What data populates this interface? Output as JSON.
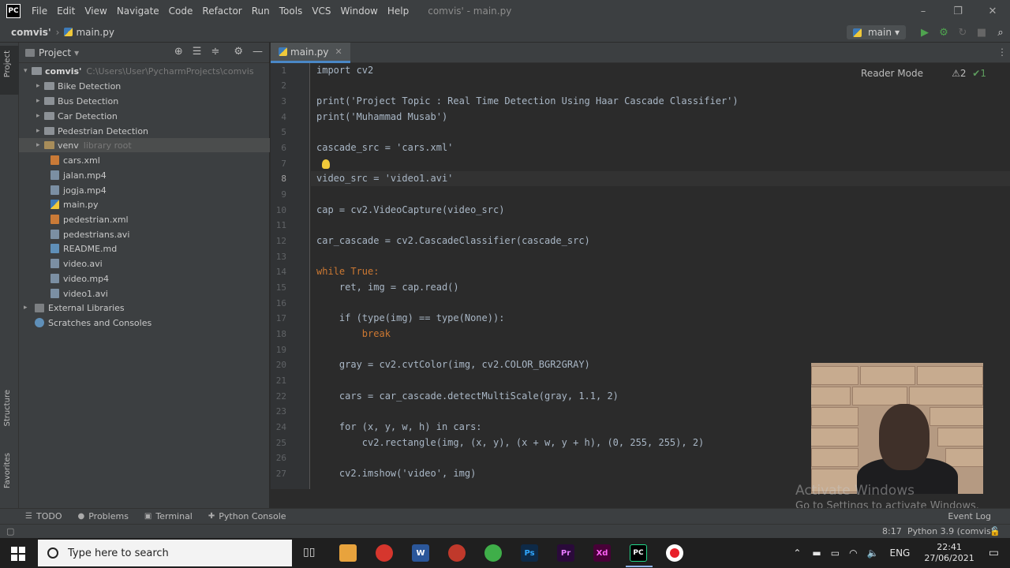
{
  "app": {
    "logo": "PC",
    "menu": [
      "File",
      "Edit",
      "View",
      "Navigate",
      "Code",
      "Refactor",
      "Run",
      "Tools",
      "VCS",
      "Window",
      "Help"
    ],
    "title": "comvis' - main.py",
    "window_buttons": [
      "–",
      "❐",
      "✕"
    ]
  },
  "navbar": {
    "project": "comvis'",
    "file": "main.py",
    "run_config": "main",
    "tool_icons": [
      "▶",
      "⚙",
      "↻",
      "■",
      "⌕"
    ]
  },
  "leftstrip": {
    "project_label": "Project",
    "structure_label": "Structure",
    "favorites_label": "Favorites"
  },
  "project_panel": {
    "header": "Project",
    "root": {
      "name": "comvis'",
      "path": "C:\\Users\\User\\PycharmProjects\\comvis"
    },
    "folders": [
      {
        "name": "Bike Detection"
      },
      {
        "name": "Bus Detection"
      },
      {
        "name": "Car Detection"
      },
      {
        "name": "Pedestrian Detection"
      },
      {
        "name": "venv",
        "hint": "library root"
      }
    ],
    "files": [
      {
        "name": "cars.xml",
        "type": "xml"
      },
      {
        "name": "jalan.mp4",
        "type": "vid"
      },
      {
        "name": "jogja.mp4",
        "type": "vid"
      },
      {
        "name": "main.py",
        "type": "py"
      },
      {
        "name": "pedestrian.xml",
        "type": "xml"
      },
      {
        "name": "pedestrians.avi",
        "type": "vid"
      },
      {
        "name": "README.md",
        "type": "md"
      },
      {
        "name": "video.avi",
        "type": "vid"
      },
      {
        "name": "video.mp4",
        "type": "vid"
      },
      {
        "name": "video1.avi",
        "type": "vid"
      }
    ],
    "external_libraries": "External Libraries",
    "scratches": "Scratches and Consoles"
  },
  "editor": {
    "tab": "main.py",
    "reader_mode": "Reader Mode",
    "warnings": "⚠2",
    "checks": "✔1",
    "line_numbers": [
      "1",
      "2",
      "3",
      "4",
      "5",
      "6",
      "7",
      "8",
      "9",
      "10",
      "11",
      "12",
      "13",
      "14",
      "15",
      "16",
      "17",
      "18",
      "19",
      "20",
      "21",
      "22",
      "23",
      "24",
      "25",
      "26",
      "27"
    ],
    "code": {
      "l1": "import cv2",
      "l3": "print('Project Topic : Real Time Detection Using Haar Cascade Classifier')",
      "l4": "print('Muhammad Musab')",
      "l6": "cascade_src = 'cars.xml'",
      "l8": "video_src = 'video1.avi'",
      "l10": "cap = cv2.VideoCapture(video_src)",
      "l12": "car_cascade = cv2.CascadeClassifier(cascade_src)",
      "l14": "while True:",
      "l15": "    ret, img = cap.read()",
      "l17": "    if (type(img) == type(None)):",
      "l18": "        break",
      "l20": "    gray = cv2.cvtColor(img, cv2.COLOR_BGR2GRAY)",
      "l22": "    cars = car_cascade.detectMultiScale(gray, 1.1, 2)",
      "l24": "    for (x, y, w, h) in cars:",
      "l25": "        cv2.rectangle(img, (x, y), (x + w, y + h), (0, 255, 255), 2)",
      "l27": "    cv2.imshow('video', img)"
    }
  },
  "watermark": {
    "line1": "Activate Windows",
    "line2": "Go to Settings to activate Windows."
  },
  "bottom_tools": {
    "todo": "TODO",
    "problems": "Problems",
    "terminal": "Terminal",
    "python_console": "Python Console",
    "event_log": "Event Log"
  },
  "status": {
    "position": "8:17",
    "interpreter": "Python 3.9 (comvis')"
  },
  "taskbar": {
    "search_placeholder": "Type here to search",
    "language": "ENG",
    "time": "22:41",
    "date": "27/06/2021",
    "apps": [
      {
        "label": "",
        "color": "#e8a33d"
      },
      {
        "label": "",
        "color": "#d6362d"
      },
      {
        "label": "W",
        "color": "#2b579a"
      },
      {
        "label": "",
        "color": "#c0392b"
      },
      {
        "label": "",
        "color": "#3fae49"
      },
      {
        "label": "Ps",
        "color": "#0e2a47"
      },
      {
        "label": "Pr",
        "color": "#2a0a3a"
      },
      {
        "label": "Xd",
        "color": "#470137"
      },
      {
        "label": "PC",
        "color": "#000000"
      },
      {
        "label": "",
        "color": "#e8202a"
      }
    ]
  }
}
